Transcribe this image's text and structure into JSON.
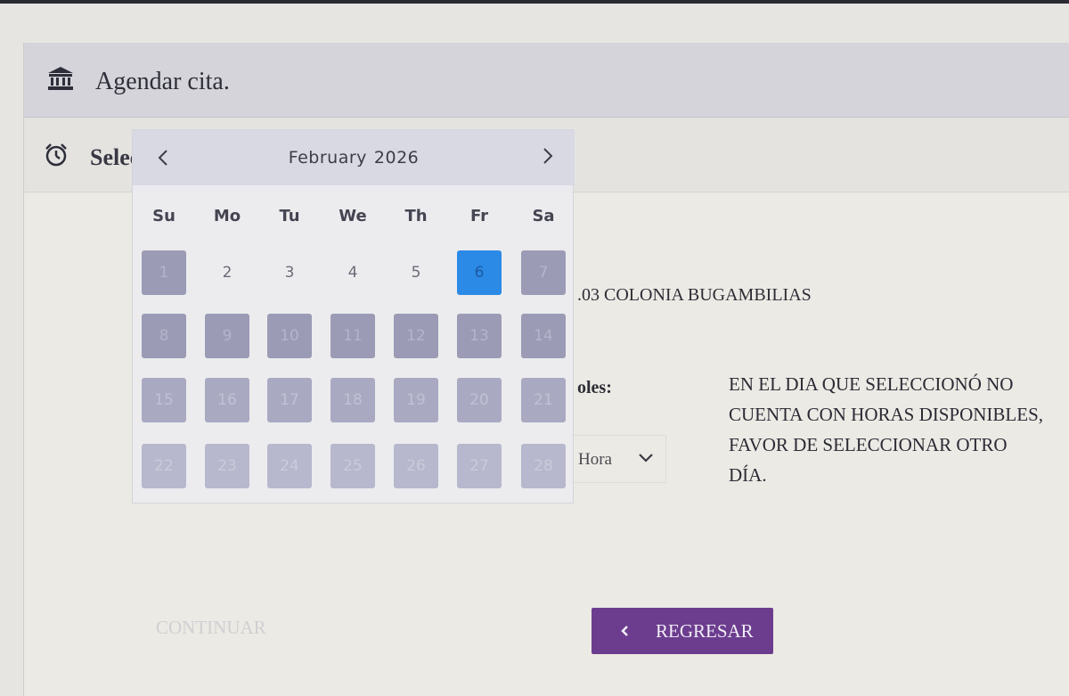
{
  "header": {
    "title": "Agendar cita.",
    "icon": "institution-icon"
  },
  "subheader": {
    "title": "Selec",
    "icon": "alarm-clock-icon"
  },
  "address": ".03 COLONIA BUGAMBILIAS",
  "horas": {
    "label": "oles:",
    "select_value": "Hora"
  },
  "message": "EN EL DIA QUE SELECCIONÓ NO CUENTA CON HORAS DISPONIBLES, FAVOR DE SELECCIONAR OTRO DÍA.",
  "buttons": {
    "continuar": "CONTINUAR",
    "regresar": "REGRESAR"
  },
  "calendar": {
    "month": "February",
    "year": "2026",
    "weekdays": [
      "Su",
      "Mo",
      "Tu",
      "We",
      "Th",
      "Fr",
      "Sa"
    ],
    "days": [
      {
        "label": "1",
        "state": "disabled"
      },
      {
        "label": "2",
        "state": "available"
      },
      {
        "label": "3",
        "state": "available"
      },
      {
        "label": "4",
        "state": "available"
      },
      {
        "label": "5",
        "state": "available"
      },
      {
        "label": "6",
        "state": "selected"
      },
      {
        "label": "7",
        "state": "disabled"
      },
      {
        "label": "8",
        "state": "disabled"
      },
      {
        "label": "9",
        "state": "disabled"
      },
      {
        "label": "10",
        "state": "disabled"
      },
      {
        "label": "11",
        "state": "disabled"
      },
      {
        "label": "12",
        "state": "disabled"
      },
      {
        "label": "13",
        "state": "disabled"
      },
      {
        "label": "14",
        "state": "disabled"
      },
      {
        "label": "15",
        "state": "disabled"
      },
      {
        "label": "16",
        "state": "disabled"
      },
      {
        "label": "17",
        "state": "disabled"
      },
      {
        "label": "18",
        "state": "disabled"
      },
      {
        "label": "19",
        "state": "disabled"
      },
      {
        "label": "20",
        "state": "disabled"
      },
      {
        "label": "21",
        "state": "disabled"
      },
      {
        "label": "22",
        "state": "disabled"
      },
      {
        "label": "23",
        "state": "disabled"
      },
      {
        "label": "24",
        "state": "disabled"
      },
      {
        "label": "25",
        "state": "disabled"
      },
      {
        "label": "26",
        "state": "disabled"
      },
      {
        "label": "27",
        "state": "disabled"
      },
      {
        "label": "28",
        "state": "disabled"
      }
    ]
  },
  "colors": {
    "accent": "#6c3d8f",
    "selected_day": "#2b8ae6",
    "disabled_day": "#9b9bb5"
  }
}
